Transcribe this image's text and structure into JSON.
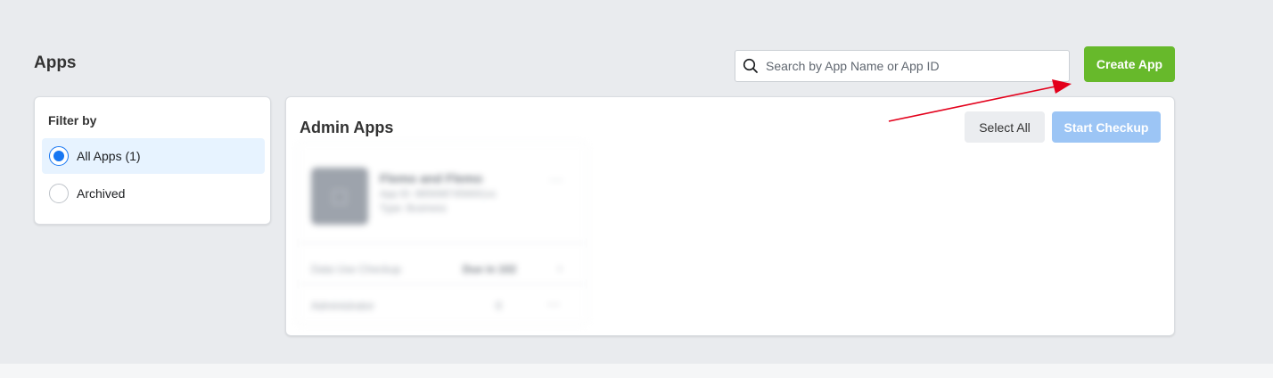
{
  "page": {
    "title": "Apps"
  },
  "search": {
    "placeholder": "Search by App Name or App ID",
    "value": ""
  },
  "header": {
    "create_label": "Create App"
  },
  "filter": {
    "title": "Filter by",
    "options": [
      {
        "label": "All Apps (1)",
        "selected": true
      },
      {
        "label": "Archived",
        "selected": false
      }
    ]
  },
  "main": {
    "section_title": "Admin Apps",
    "select_all_label": "Select All",
    "checkup_label": "Start Checkup",
    "app_card": {
      "name": "Flemo and Flemo",
      "app_id": "App ID: 8856987456691xx",
      "type": "Type: Business",
      "checkup_label": "Data Use Checkup",
      "checkup_status": "Due in 102",
      "admin_label": "Administrator",
      "admin_count": "0"
    }
  },
  "colors": {
    "page_bg": "#e9ebee",
    "create_button": "#67b92b",
    "checkup_button_disabled": "#9cc5f5",
    "selected_filter_bg": "#e7f3ff",
    "radio_accent": "#1877f2",
    "annotation_arrow": "#e3001b"
  },
  "icons": {
    "search": "search-icon",
    "radio_checked": "radio-checked-icon",
    "radio_unchecked": "radio-unchecked-icon"
  }
}
